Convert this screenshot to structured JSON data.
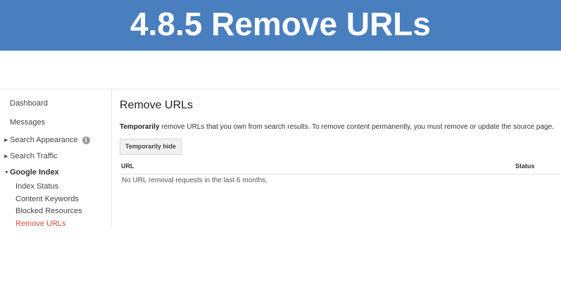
{
  "banner": {
    "title": "4.8.5 Remove URLs"
  },
  "sidebar": {
    "items": [
      {
        "label": "Dashboard"
      },
      {
        "label": "Messages"
      },
      {
        "label": "Search Appearance"
      },
      {
        "label": "Search Traffic"
      },
      {
        "label": "Google Index"
      },
      {
        "label": "Index Status"
      },
      {
        "label": "Content Keywords"
      },
      {
        "label": "Blocked Resources"
      },
      {
        "label": "Remove URLs"
      }
    ]
  },
  "main": {
    "title": "Remove URLs",
    "description_bold": "Temporarily",
    "description_rest": " remove URLs that you own from search results. To remove content permanently, you must remove or update the source page.",
    "button_label": "Temporarily hide",
    "table": {
      "columns": [
        "URL",
        "Status"
      ],
      "empty_message": "No URL removal requests in the last 6 months."
    }
  },
  "colors": {
    "banner": "#4a7fbf",
    "active_nav": "#dd4b39"
  },
  "icons": {
    "info": "info-icon",
    "collapsed": "triangle-right-icon",
    "expanded": "triangle-down-icon"
  }
}
